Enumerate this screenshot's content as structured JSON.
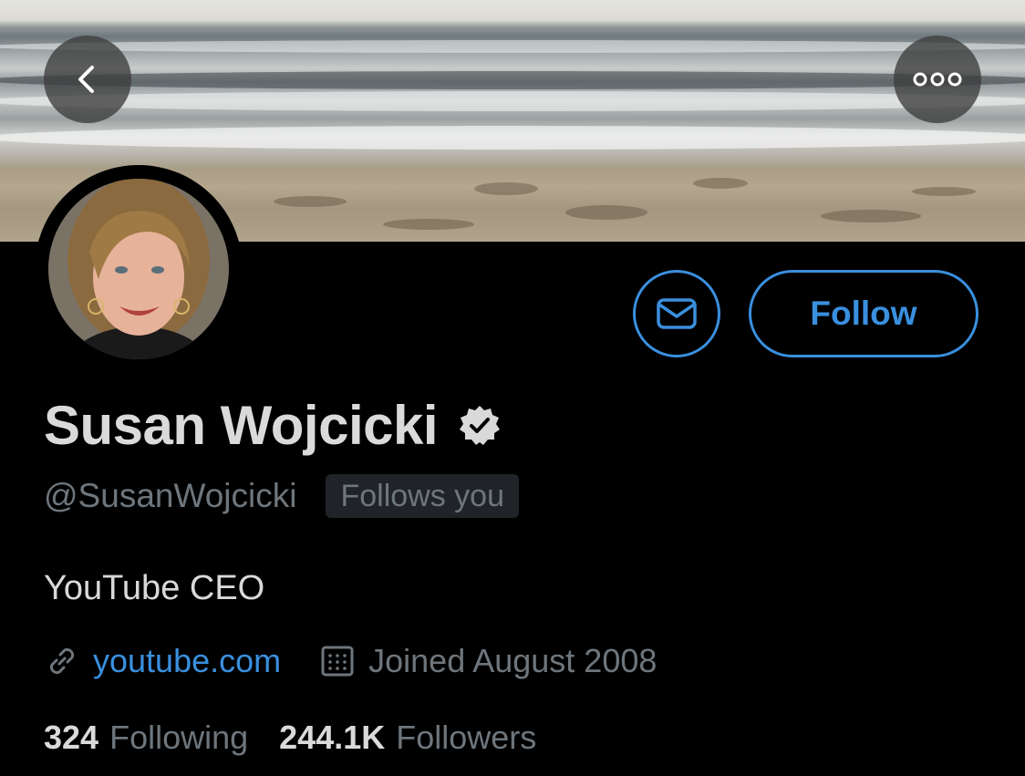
{
  "header": {
    "back_icon": "chevron-left-icon",
    "more_icon": "more-horizontal-icon"
  },
  "profile": {
    "name": "Susan Wojcicki",
    "handle": "@SusanWojcicki",
    "follows_you": "Follows you",
    "bio": "YouTube CEO",
    "website": "youtube.com",
    "joined": "Joined August 2008",
    "verified": true
  },
  "actions": {
    "message_icon": "mail-icon",
    "follow_label": "Follow"
  },
  "stats": {
    "following_count": "324",
    "following_label": "Following",
    "followers_count": "244.1K",
    "followers_label": "Followers"
  },
  "colors": {
    "accent": "#3a8fde",
    "background": "#000000",
    "muted": "#6e767d"
  }
}
